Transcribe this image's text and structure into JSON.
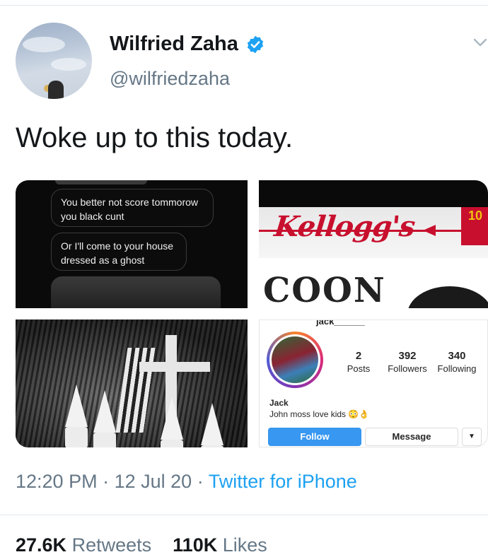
{
  "tweet": {
    "author_name": "Wilfried Zaha",
    "handle": "@wilfriedzaha",
    "text": "Woke up to this today.",
    "time": "12:20 PM",
    "separator": "·",
    "date": "12 Jul 20",
    "source": "Twitter for iPhone",
    "retweets_count": "27.6K",
    "retweets_label": "Retweets",
    "likes_count": "110K",
    "likes_label": "Likes"
  },
  "media": {
    "messages": {
      "bubble_1": "You better not score tommorow you black cunt",
      "bubble_2": "Or I'll come to your house dressed as a ghost"
    },
    "cereal": {
      "brand": "Kellogg's",
      "word": "COON",
      "tag": "10"
    },
    "instagram": {
      "username": "jack______",
      "posts_count": "2",
      "posts_label": "Posts",
      "followers_count": "392",
      "followers_label": "Followers",
      "following_count": "340",
      "following_label": "Following",
      "display_name": "Jack",
      "bio": "John moss love kids 😳👌",
      "follow_label": "Follow",
      "message_label": "Message"
    }
  },
  "colors": {
    "verified_blue": "#1da1f2",
    "link_blue": "#1da1f2",
    "text_dark": "#14171a",
    "text_muted": "#657786",
    "instagram_blue": "#3897f0"
  },
  "icons": [
    "verified-badge-icon",
    "chevron-down-icon"
  ]
}
